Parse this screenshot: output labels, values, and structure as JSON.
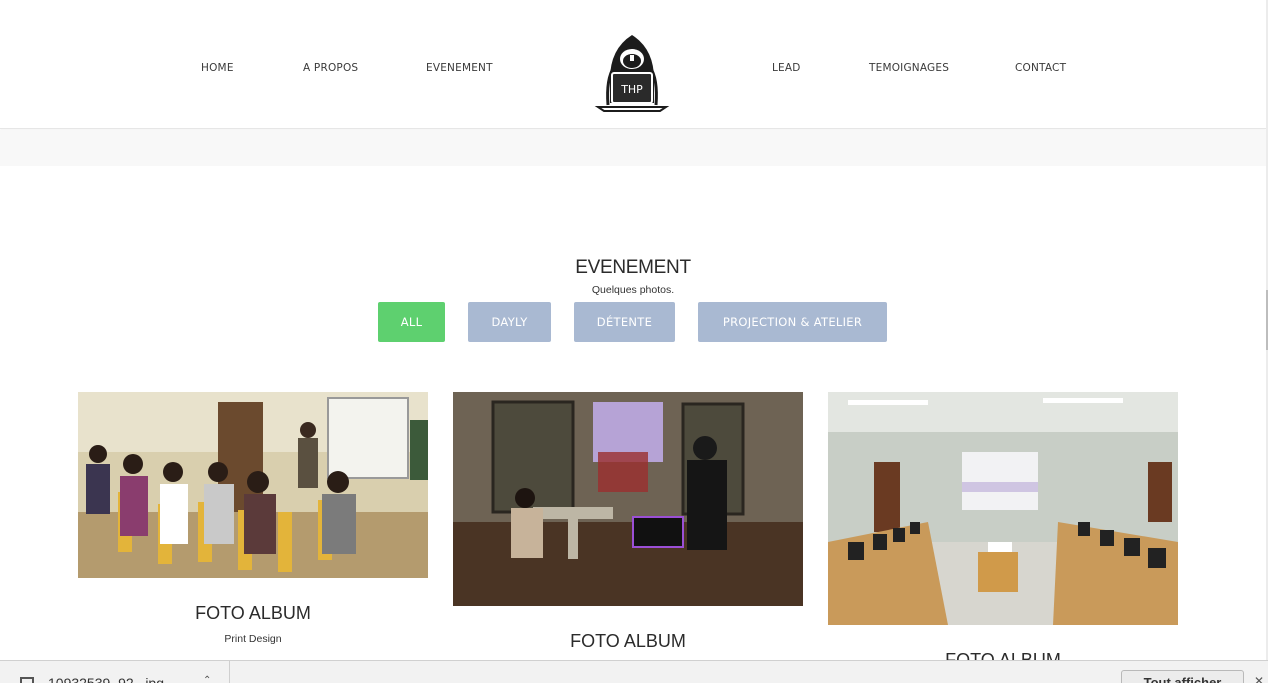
{
  "nav": {
    "left": [
      {
        "label": "HOME"
      },
      {
        "label": "A PROPOS"
      },
      {
        "label": "EVENEMENT"
      }
    ],
    "right": [
      {
        "label": "LEAD"
      },
      {
        "label": "TEMOIGNAGES"
      },
      {
        "label": "CONTACT"
      }
    ],
    "logo_text": "THP"
  },
  "section": {
    "title": "EVENEMENT",
    "subtitle": "Quelques photos."
  },
  "filters": [
    {
      "label": "ALL",
      "active": true
    },
    {
      "label": "DAYLY",
      "active": false
    },
    {
      "label": "DÉTENTE",
      "active": false
    },
    {
      "label": "PROJECTION & ATELIER",
      "active": false
    }
  ],
  "cards": [
    {
      "title": "FOTO ALBUM",
      "subtitle": "Print Design",
      "image": "classroom-presentation-photo"
    },
    {
      "title": "FOTO ALBUM",
      "subtitle": "",
      "image": "dark-room-projection-photo"
    },
    {
      "title": "FOTO ALBUM",
      "subtitle": "",
      "image": "computer-lab-projector-photo"
    }
  ],
  "download_bar": {
    "file_name": "10932539_92...jpg",
    "show_all_label": "Tout afficher",
    "close_icon": "close-icon"
  },
  "colors": {
    "filter_active": "#5ed06f",
    "filter_inactive": "#a9b9d2",
    "text_dark": "#2b2b2b"
  }
}
